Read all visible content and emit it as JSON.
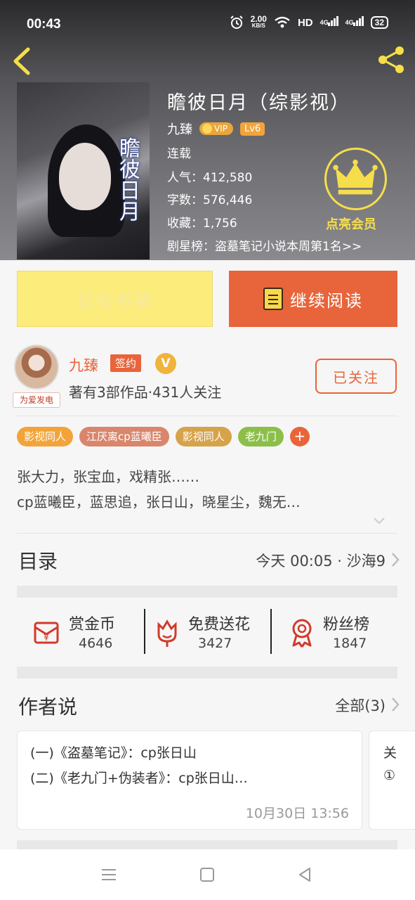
{
  "status_bar": {
    "time": "00:43",
    "speed_value": "2.00",
    "speed_unit": "KB/S",
    "hd": "HD",
    "net1": "4G",
    "net2": "4G",
    "battery": "32"
  },
  "book": {
    "title": "瞻彼日月（综影视）",
    "cover_title": "瞻彼日月",
    "author": "九臻",
    "vip_label": "VIP",
    "level": "Lv6",
    "status": "连载",
    "popularity": "人气：412,580",
    "words": "字数：576,446",
    "favorites": "收藏：1,756",
    "rank": "剧星榜：盗墓笔记小说本周第1名>>"
  },
  "vip_cta": "点亮会员",
  "actions": {
    "shelf": "已在书架",
    "read": "继续阅读"
  },
  "author_card": {
    "name": "九臻",
    "sign": "签约",
    "v": "V",
    "works": "著有3部作品·431人关注",
    "avatar_tag": "为爱发电",
    "follow": "已关注"
  },
  "tags": [
    {
      "label": "影视同人",
      "color": "#f2a43a"
    },
    {
      "label": "江厌离cp蓝曦臣",
      "color": "#d9866c"
    },
    {
      "label": "影视同人",
      "color": "#d6a24a"
    },
    {
      "label": "老九门",
      "color": "#8cbf4a"
    }
  ],
  "tag_add": "+",
  "description": [
    "张大力，张宝血，戏精张……",
    "cp蓝曦臣，蓝思追，张日山，晓星尘，魏无…"
  ],
  "catalog": {
    "title": "目录",
    "latest": "今天 00:05 · 沙海9"
  },
  "stats": [
    {
      "label": "赏金币",
      "value": "4646",
      "icon": "red-envelope-icon"
    },
    {
      "label": "免费送花",
      "value": "3427",
      "icon": "flower-icon"
    },
    {
      "label": "粉丝榜",
      "value": "1847",
      "icon": "medal-icon"
    }
  ],
  "author_says": {
    "title": "作者说",
    "all": "全部(3)",
    "note": {
      "line1": "(一)《盗墓笔记》：cp张日山",
      "line2": "(二)《老九门+伪装者》：cp张日山…",
      "time": "10月30日  13:56"
    },
    "next_note": {
      "line1": "关",
      "line2": "①"
    }
  },
  "colors": {
    "accent": "#e8643a",
    "gold": "#f5de4a",
    "shelf": "#fbec7c"
  }
}
